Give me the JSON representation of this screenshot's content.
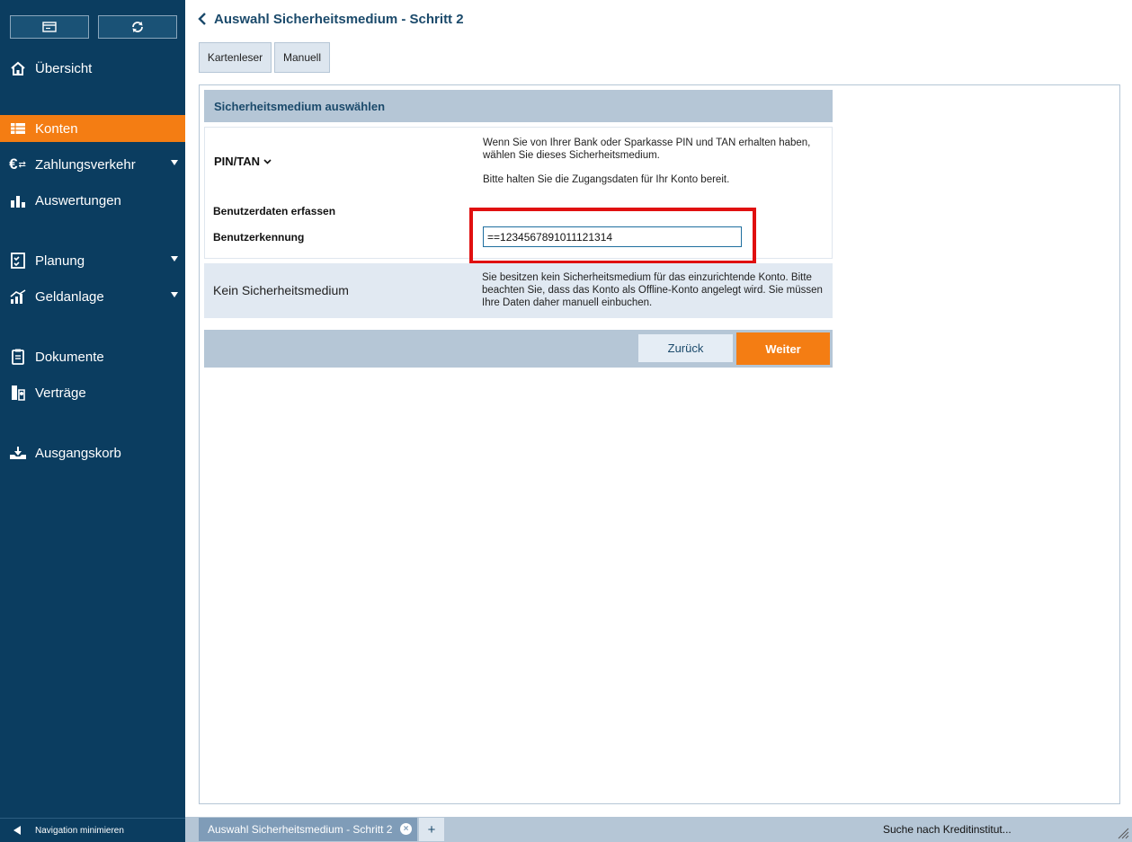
{
  "sidebar": {
    "top_buttons": [
      {
        "icon": "card-icon"
      },
      {
        "icon": "refresh-icon"
      }
    ],
    "items": [
      {
        "label": "Übersicht",
        "icon": "home-icon",
        "has_submenu": false,
        "active": false
      },
      {
        "label": "Konten",
        "icon": "accounts-icon",
        "has_submenu": false,
        "active": true
      },
      {
        "label": "Zahlungsverkehr",
        "icon": "euro-transfer-icon",
        "has_submenu": true,
        "active": false
      },
      {
        "label": "Auswertungen",
        "icon": "bar-chart-icon",
        "has_submenu": false,
        "active": false
      },
      {
        "label": "Planung",
        "icon": "planning-icon",
        "has_submenu": true,
        "active": false
      },
      {
        "label": "Geldanlage",
        "icon": "growth-chart-icon",
        "has_submenu": true,
        "active": false
      },
      {
        "label": "Dokumente",
        "icon": "documents-icon",
        "has_submenu": false,
        "active": false
      },
      {
        "label": "Verträge",
        "icon": "contracts-icon",
        "has_submenu": false,
        "active": false
      },
      {
        "label": "Ausgangskorb",
        "icon": "outbox-icon",
        "has_submenu": false,
        "active": false
      }
    ],
    "minimize_label": "Navigation minimieren"
  },
  "header": {
    "title": "Auswahl Sicherheitsmedium - Schritt 2"
  },
  "tabs": [
    "Kartenleser",
    "Manuell"
  ],
  "section": {
    "title": "Sicherheitsmedium auswählen",
    "pin_tan": {
      "label": "PIN/TAN",
      "description_1": "Wenn Sie von Ihrer Bank oder Sparkasse PIN und TAN erhalten haben, wählen Sie dieses Sicherheitsmedium.",
      "description_2": "Bitte halten Sie die Zugangsdaten für Ihr Konto bereit.",
      "form_heading": "Benutzerdaten erfassen",
      "user_id_label": "Benutzerkennung",
      "user_id_value": "==1234567891011121314"
    },
    "none": {
      "label": "Kein Sicherheitsmedium",
      "description": "Sie besitzen kein Sicherheitsmedium für das einzurichtende Konto. Bitte beachten Sie, dass das Konto als Offline-Konto angelegt wird. Sie müssen Ihre Daten daher manuell einbuchen."
    }
  },
  "actions": {
    "back_label": "Zurück",
    "next_label": "Weiter"
  },
  "statusbar": {
    "open_tab": "Auswahl Sicherheitsmedium - Schritt 2",
    "add_tab": "+",
    "status": "Suche nach Kreditinstitut..."
  },
  "colors": {
    "sidebar_bg": "#0b3d60",
    "accent": "#f47d13",
    "panel_header": "#b5c6d6",
    "highlight": "#e01010"
  }
}
